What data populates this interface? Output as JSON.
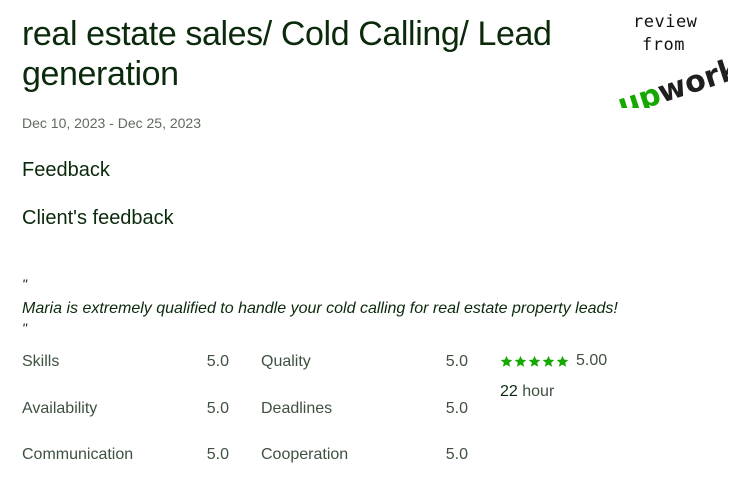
{
  "header": {
    "title": "real estate sales/ Cold Calling/ Lead generation",
    "dates": "Dec 10, 2023 - Dec 25, 2023"
  },
  "feedback": {
    "heading": "Feedback",
    "client_heading": "Client's feedback",
    "quote_open": "\"",
    "quote_text": "Maria is extremely qualified to handle your cold calling for real estate property leads!",
    "quote_close": "\""
  },
  "ratings": {
    "skills": {
      "label": "Skills",
      "value": "5.0"
    },
    "quality": {
      "label": "Quality",
      "value": "5.0"
    },
    "availability": {
      "label": "Availability",
      "value": "5.0"
    },
    "deadlines": {
      "label": "Deadlines",
      "value": "5.0"
    },
    "communication": {
      "label": "Communication",
      "value": "5.0"
    },
    "cooperation": {
      "label": "Cooperation",
      "value": "5.0"
    },
    "overall": "5.00",
    "stars_filled": 5,
    "stars_total": 5
  },
  "hours": {
    "value": "22",
    "unit": "hour"
  },
  "stamp": {
    "review": "review",
    "from": "from",
    "logo_up": "up",
    "logo_work": "work"
  },
  "colors": {
    "star": "#14a800",
    "logo_up": "#14a800",
    "logo_work": "#1f1f1f"
  },
  "icons": {
    "star": "star-icon",
    "logo": "upwork-logo"
  }
}
